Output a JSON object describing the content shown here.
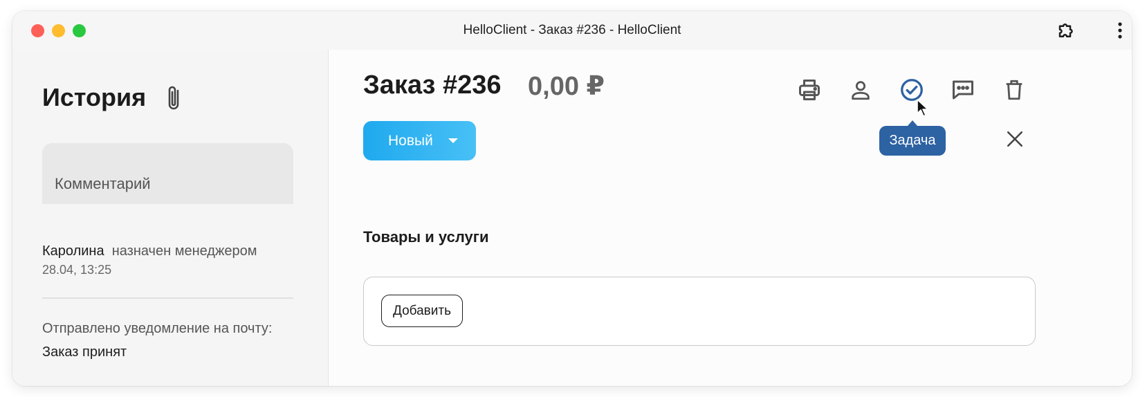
{
  "window": {
    "title": "HelloClient - Заказ #236 - HelloClient"
  },
  "sidebar": {
    "title": "История",
    "comment_placeholder": "Комментарий",
    "events": [
      {
        "actor": "Каролина",
        "action": "назначен менеджером",
        "time": "28.04, 13:25"
      },
      {
        "text_prefix": "Отправлено уведомление на почту:",
        "text_value": "Заказ принят"
      }
    ]
  },
  "order": {
    "title": "Заказ #236",
    "amount": "0,00 ₽",
    "status": "Новый",
    "tooltip": "Задача",
    "section_title": "Товары и услуги",
    "add_label": "Добавить"
  },
  "icons": {
    "toolbar": [
      "print-icon",
      "user-icon",
      "task-icon",
      "chat-icon",
      "trash-icon"
    ],
    "title_bar": [
      "extension-icon",
      "kebab-menu-icon"
    ]
  },
  "colors": {
    "status_button": "#1fa9ee",
    "tooltip": "#2d62a3",
    "task_icon": "#2d62a3"
  }
}
